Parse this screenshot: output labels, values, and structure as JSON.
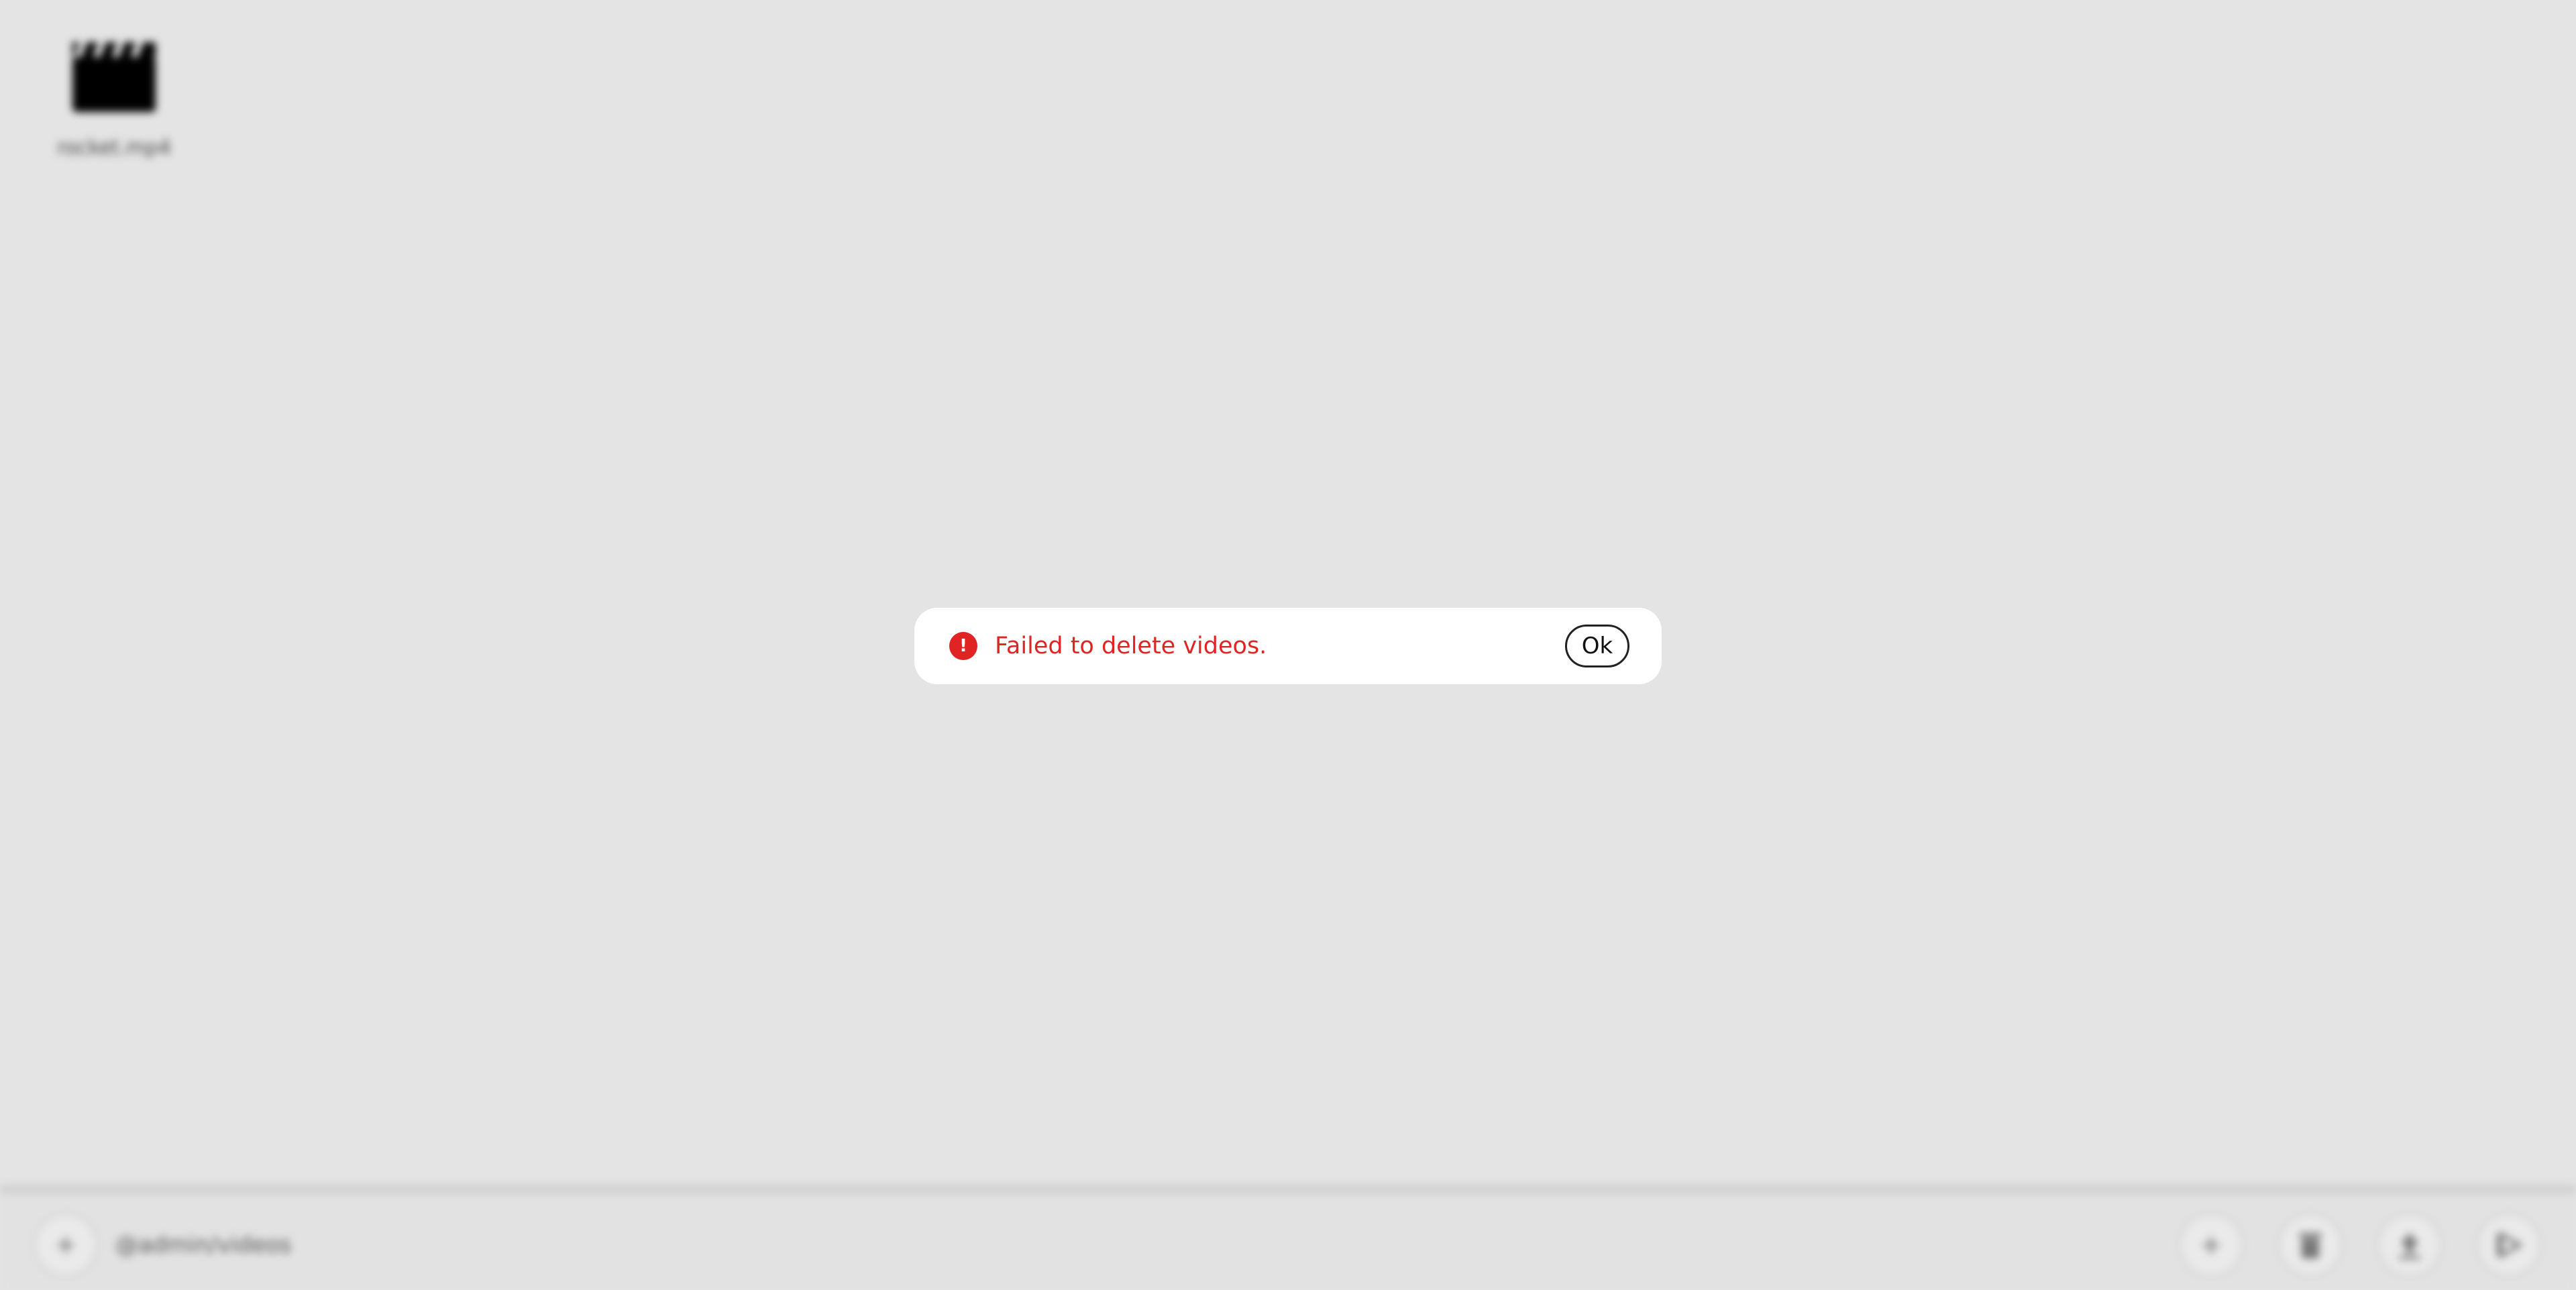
{
  "desktop": {
    "files": [
      {
        "name": "rocket.mp4",
        "icon": "video-clapperboard-icon"
      }
    ]
  },
  "bottom_bar": {
    "user": "@admin/videos",
    "left_button_icon": "plus-icon",
    "actions": [
      {
        "icon": "plus-icon"
      },
      {
        "icon": "trash-icon"
      },
      {
        "icon": "upload-icon"
      },
      {
        "icon": "play-icon"
      }
    ]
  },
  "dialog": {
    "icon": "error-icon",
    "icon_glyph": "!",
    "message": "Failed to delete videos.",
    "ok_label": "Ok",
    "color": "#e02424"
  }
}
